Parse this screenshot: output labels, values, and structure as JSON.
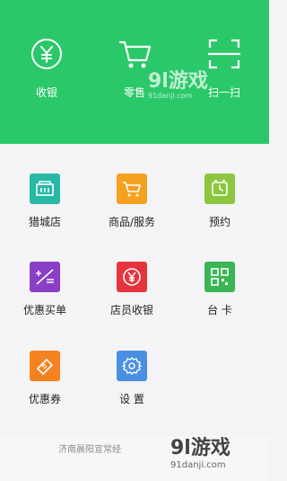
{
  "header": {
    "items": [
      {
        "label": "收银",
        "icon": "yuan-circle-icon"
      },
      {
        "label": "零售",
        "icon": "shopping-cart-icon"
      },
      {
        "label": "扫一扫",
        "icon": "scan-icon"
      }
    ],
    "color": "#2bc86a"
  },
  "grid": {
    "items": [
      {
        "label": "猎城店",
        "icon": "store-icon",
        "color": "#27b8a6"
      },
      {
        "label": "商品/服务",
        "icon": "cart-icon",
        "color": "#f5a01f"
      },
      {
        "label": "预约",
        "icon": "alarm-clock-icon",
        "color": "#8cc63f"
      },
      {
        "label": "优惠买单",
        "icon": "discount-calc-icon",
        "color": "#8a3fc6"
      },
      {
        "label": "店员收银",
        "icon": "yuan-icon",
        "color": "#e5343d"
      },
      {
        "label": "台 卡",
        "icon": "qr-code-icon",
        "color": "#3cb554"
      },
      {
        "label": "优惠券",
        "icon": "coupon-icon",
        "color": "#f58220"
      },
      {
        "label": "设 置",
        "icon": "gear-icon",
        "color": "#4a90e2"
      }
    ]
  },
  "footer": {
    "text": "济南晨阳宣常经"
  },
  "watermark": {
    "top_main": "9l游戏",
    "top_sub": "91danji.com",
    "bottom_main": "9l游戏",
    "bottom_sub": "91danji.com"
  }
}
